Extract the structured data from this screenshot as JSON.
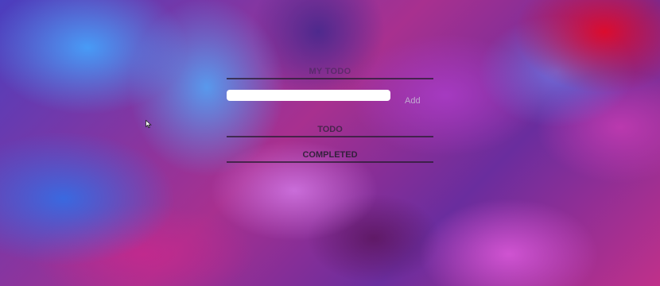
{
  "app": {
    "title": "MY TODO"
  },
  "new_task": {
    "value": "",
    "placeholder": "",
    "add_label": "Add"
  },
  "sections": {
    "todo": {
      "title": "TODO",
      "items": []
    },
    "completed": {
      "title": "COMPLETED",
      "items": []
    }
  },
  "icons": {
    "cursor": "mouse-pointer-icon"
  },
  "colors": {
    "input_background": "#ffffff",
    "rule": "#2a1e32"
  }
}
